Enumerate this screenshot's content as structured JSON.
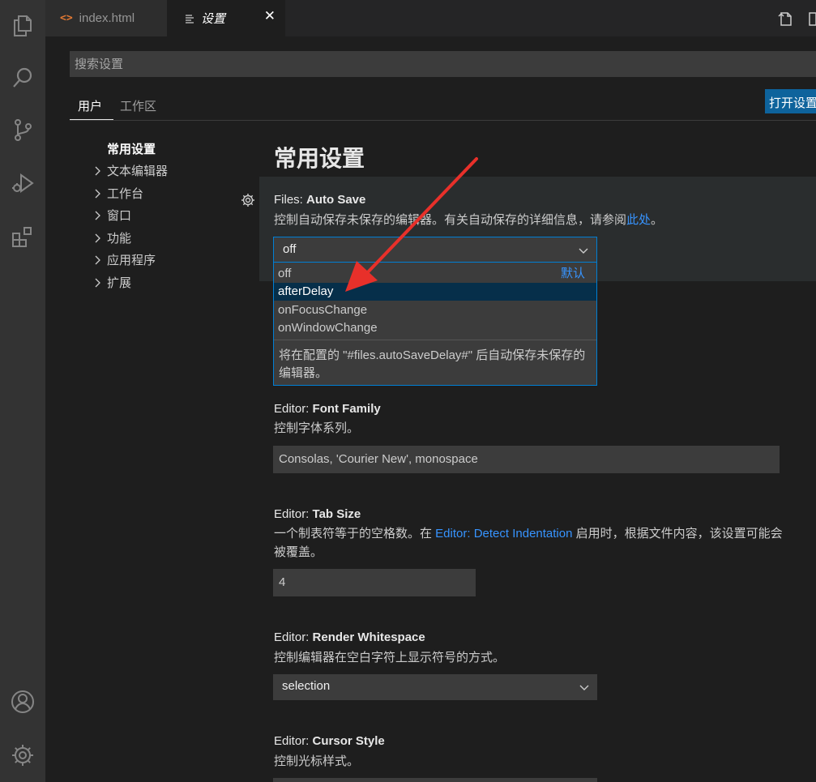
{
  "tabs": {
    "index": {
      "icon": "<>",
      "label": "index.html"
    },
    "settings": {
      "label": "设置",
      "close": "✕"
    }
  },
  "search": {
    "placeholder": "搜索设置"
  },
  "scope": {
    "user": "用户",
    "workspace": "工作区",
    "open_json": "打开设置"
  },
  "toc": {
    "heading": "常用设置",
    "items": [
      "文本编辑器",
      "工作台",
      "窗口",
      "功能",
      "应用程序",
      "扩展"
    ]
  },
  "section_title": "常用设置",
  "settings": {
    "auto_save": {
      "category": "Files: ",
      "key": "Auto Save",
      "desc_prefix": "控制自动保存未保存的编辑器。有关自动保存的详细信息，请参阅",
      "desc_link": "此处",
      "desc_suffix": "。",
      "value": "off",
      "options": [
        "off",
        "afterDelay",
        "onFocusChange",
        "onWindowChange"
      ],
      "default_label": "默认",
      "highlighted_option": "afterDelay",
      "option_desc": "将在配置的 \"#files.autoSaveDelay#\" 后自动保存未保存的编辑器。"
    },
    "font_family": {
      "category": "Editor: ",
      "key": "Font Family",
      "desc": "控制字体系列。",
      "value": "Consolas, 'Courier New', monospace"
    },
    "tab_size": {
      "category": "Editor: ",
      "key": "Tab Size",
      "desc_prefix": "一个制表符等于的空格数。在 ",
      "desc_link": "Editor: Detect Indentation",
      "desc_suffix": " 启用时，根据文件内容，该设置可能会",
      "desc_line2": "被覆盖。",
      "value": "4"
    },
    "render_whitespace": {
      "category": "Editor: ",
      "key": "Render Whitespace",
      "desc": "控制编辑器在空白字符上显示符号的方式。",
      "value": "selection"
    },
    "cursor_style": {
      "category": "Editor: ",
      "key": "Cursor Style",
      "desc": "控制光标样式。"
    }
  },
  "colors": {
    "accent": "#007fd4",
    "link": "#3794ff",
    "button": "#0e639c",
    "annotation_arrow": "#e8302a"
  }
}
